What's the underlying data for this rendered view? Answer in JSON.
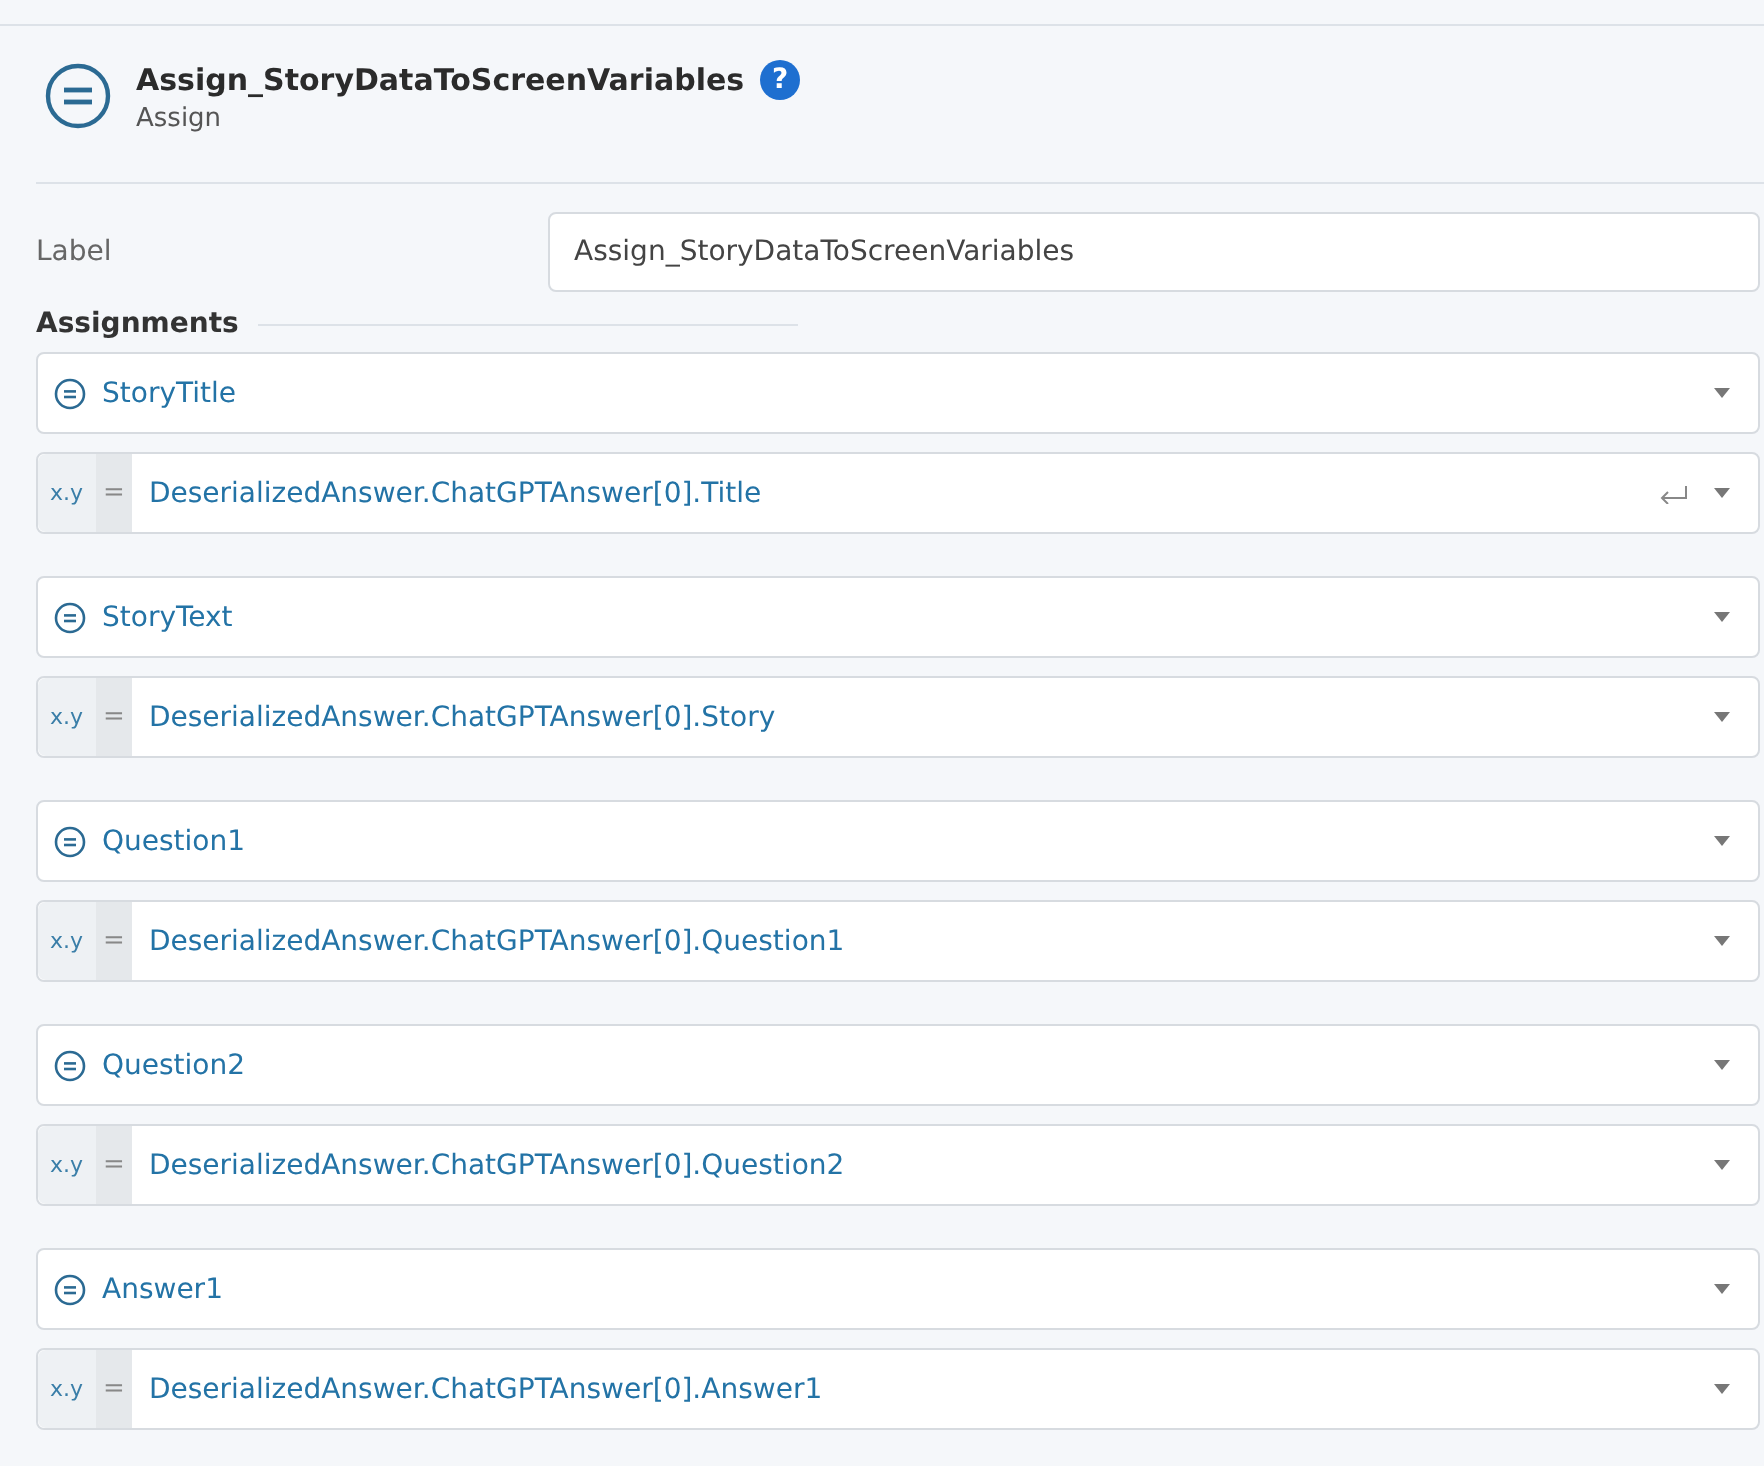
{
  "header": {
    "title": "Assign_StoryDataToScreenVariables",
    "help": "?",
    "subtitle": "Assign"
  },
  "label_field": {
    "label": "Label",
    "value": "Assign_StoryDataToScreenVariables"
  },
  "section": {
    "title": "Assignments"
  },
  "assignments": [
    {
      "variable": "StoryTitle",
      "badge": "x.y",
      "operator": "=",
      "expression": "DeserializedAnswer.ChatGPTAnswer[0].Title",
      "enter_icon": true
    },
    {
      "variable": "StoryText",
      "badge": "x.y",
      "operator": "=",
      "expression": "DeserializedAnswer.ChatGPTAnswer[0].Story",
      "enter_icon": false
    },
    {
      "variable": "Question1",
      "badge": "x.y",
      "operator": "=",
      "expression": "DeserializedAnswer.ChatGPTAnswer[0].Question1",
      "enter_icon": false
    },
    {
      "variable": "Question2",
      "badge": "x.y",
      "operator": "=",
      "expression": "DeserializedAnswer.ChatGPTAnswer[0].Question2",
      "enter_icon": false
    },
    {
      "variable": "Answer1",
      "badge": "x.y",
      "operator": "=",
      "expression": "DeserializedAnswer.ChatGPTAnswer[0].Answer1",
      "enter_icon": false
    }
  ]
}
